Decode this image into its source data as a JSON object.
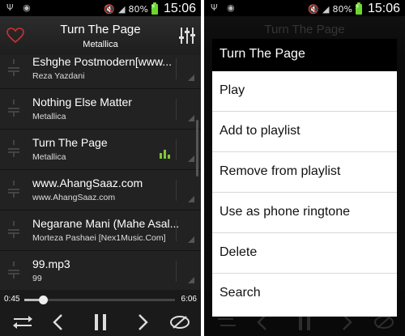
{
  "status_bar": {
    "battery_percent": "80%",
    "time": "15:06",
    "icons": [
      "usb-icon",
      "sync-icon",
      "mute-icon",
      "signal-icon",
      "battery-charging-icon"
    ]
  },
  "header": {
    "title": "Turn The Page",
    "artist": "Metallica",
    "left_icon": "heart-icon",
    "right_icon": "equalizer-icon"
  },
  "tracks": [
    {
      "title": "Eshghe Postmodern[www...",
      "artist": "Reza Yazdani",
      "playing": false
    },
    {
      "title": "Nothing Else Matter",
      "artist": "Metallica",
      "playing": false
    },
    {
      "title": "Turn The Page",
      "artist": "Metallica",
      "playing": true
    },
    {
      "title": "www.AhangSaaz.com",
      "artist": "www.AhangSaaz.com",
      "playing": false
    },
    {
      "title": "Negarane Mani (Mahe Asal...",
      "artist": "Morteza Pashaei [Nex1Music.Com]",
      "playing": false
    },
    {
      "title": "99.mp3",
      "artist": "99",
      "playing": false
    }
  ],
  "player": {
    "current_time": "0:45",
    "total_time": "6:06",
    "progress": 0.123,
    "controls": [
      "shuffle-icon",
      "previous-icon",
      "pause-icon",
      "next-icon",
      "repeat-icon"
    ]
  },
  "context_menu": {
    "title": "Turn The Page",
    "items": [
      "Play",
      "Add to playlist",
      "Remove from playlist",
      "Use as phone ringtone",
      "Delete",
      "Search"
    ]
  },
  "colors": {
    "accent_green": "#7ec832",
    "heart_red": "#d03030",
    "battery_green": "#6bd62e"
  }
}
